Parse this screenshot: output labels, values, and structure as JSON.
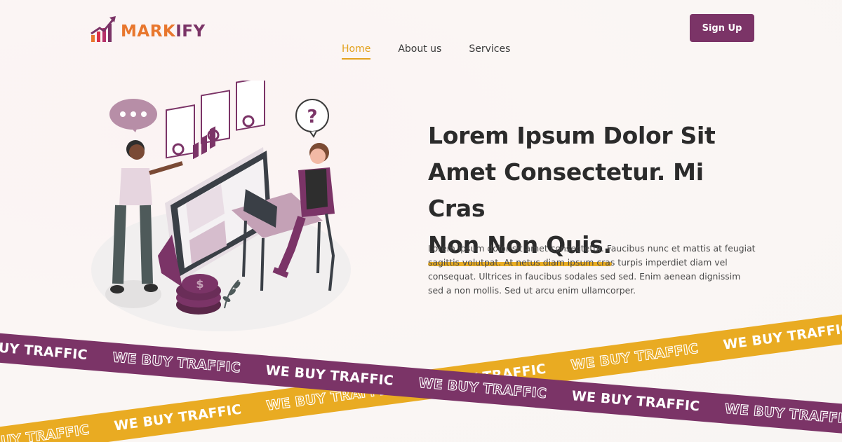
{
  "brand": {
    "name_part1": "MARK",
    "name_part2": "IFY",
    "colors": {
      "primary": "#7b3467",
      "accent": "#e9ab22",
      "logo_orange": "#e8772e"
    }
  },
  "nav": {
    "items": [
      {
        "label": "Home",
        "active": true
      },
      {
        "label": "About us",
        "active": false
      },
      {
        "label": "Services",
        "active": false
      }
    ]
  },
  "header": {
    "signup_label": "Sign Up"
  },
  "hero": {
    "title_line1": "Lorem Ipsum Dolor Sit",
    "title_line2": "Amet Consectetur. Mi Cras",
    "title_highlight": "Non Non Quis.",
    "description": "Lorem ipsum dolor sit amet consectetur. Faucibus nunc et mattis at feugiat sagittis volutpat. At netus diam ipsum cras turpis imperdiet diam vel consequat. Ultrices in faucibus sodales sed sed. Enim aenean dignissim sed a non mollis. Sed ut arcu enim ullamcorper."
  },
  "ribbons": {
    "text": "WE BUY TRAFFIC"
  },
  "illustration": {
    "speech_bubble_icon": "ellipsis-bubble-icon",
    "question_icon": "question-mark-icon",
    "coins_icon": "dollar-coins-icon"
  }
}
